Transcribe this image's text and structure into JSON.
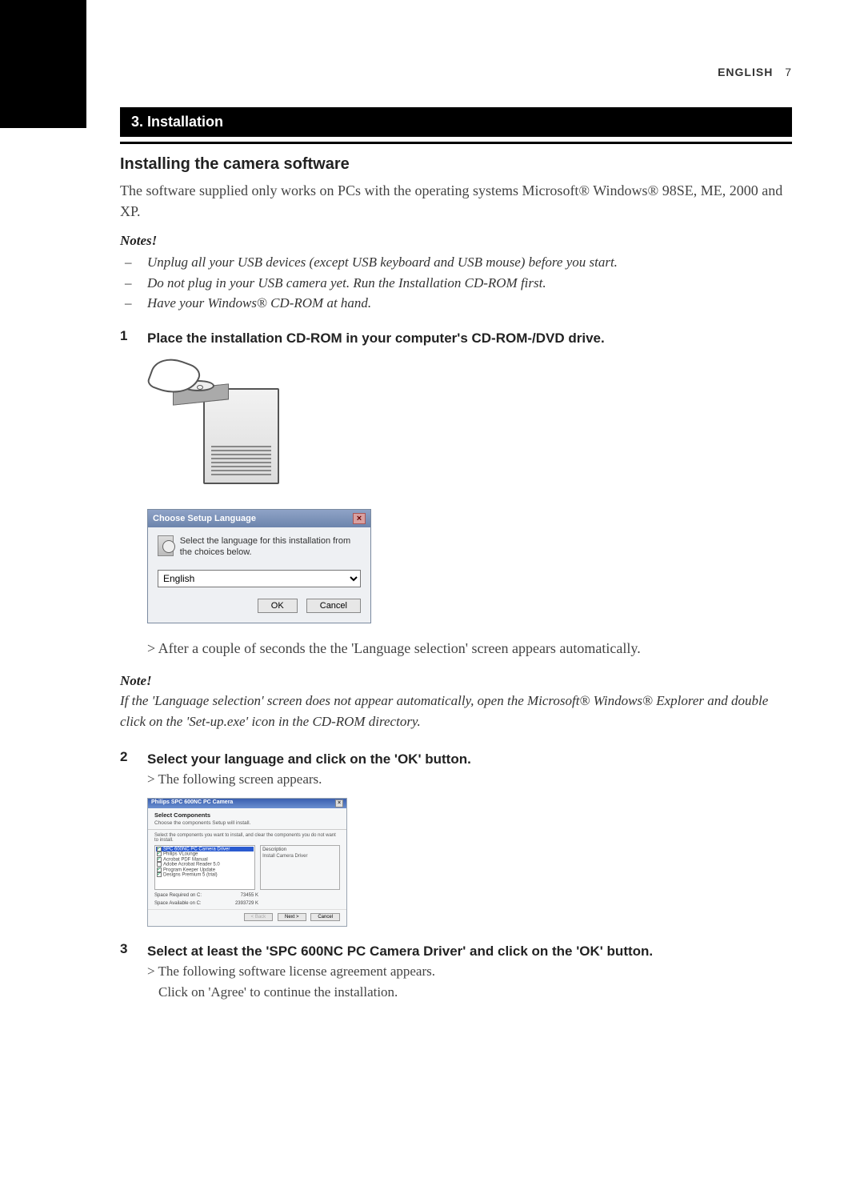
{
  "header": {
    "language": "ENGLISH",
    "page": "7"
  },
  "section": {
    "number_title": "3. Installation"
  },
  "subsection": {
    "title": "Installing the camera software"
  },
  "intro": "The software supplied only works on PCs with the operating systems Microsoft® Windows® 98SE, ME, 2000 and XP.",
  "notes1": {
    "heading": "Notes!",
    "items": [
      "Unplug all your USB devices (except USB keyboard and USB mouse) before you start.",
      "Do not plug in your USB camera yet. Run the Installation CD-ROM first.",
      "Have your Windows® CD-ROM at hand."
    ]
  },
  "step1": {
    "num": "1",
    "text": "Place the installation CD-ROM in your computer's CD-ROM-/DVD drive."
  },
  "dialog_lang": {
    "title": "Choose Setup Language",
    "message": "Select the language for this installation from the choices below.",
    "selected": "English",
    "ok": "OK",
    "cancel": "Cancel"
  },
  "step1_result": "> After a couple of seconds the the 'Language selection' screen appears automatically.",
  "note2": {
    "heading": "Note!",
    "body": "If the 'Language selection' screen does not appear automatically, open the Microsoft® Windows® Explorer and double click on the 'Set-up.exe' icon in the CD-ROM directory."
  },
  "step2": {
    "num": "2",
    "text": "Select your language and click on the 'OK' button.",
    "result": "> The following screen appears."
  },
  "dialog_components": {
    "title": "Philips SPC 600NC PC Camera",
    "heading": "Select Components",
    "sub": "Choose the components Setup will install.",
    "instruction": "Select the components you want to install, and clear the components you do not want to install.",
    "items": [
      {
        "label": "SPC 600NC PC Camera Driver",
        "checked": true,
        "selected": true
      },
      {
        "label": "Philips VLounge",
        "checked": true
      },
      {
        "label": "Acrobat PDF Manual",
        "checked": true
      },
      {
        "label": "Adobe Acrobat Reader 5.0",
        "checked": false
      },
      {
        "label": "Program Keeper Update",
        "checked": true
      },
      {
        "label": "Designs Premium 5 (trial)",
        "checked": true
      }
    ],
    "desc_label": "Description",
    "desc_text": "Install Camera Driver",
    "space_req_label": "Space Required on  C:",
    "space_req": "73455 K",
    "space_avail_label": "Space Available on  C:",
    "space_avail": "2393729 K",
    "back": "< Back",
    "next": "Next >",
    "cancel": "Cancel"
  },
  "step3": {
    "num": "3",
    "text": "Select at least the 'SPC 600NC PC Camera Driver' and click on the 'OK' button.",
    "result1": "> The following software license agreement appears.",
    "result2": "Click on 'Agree' to continue the installation."
  }
}
